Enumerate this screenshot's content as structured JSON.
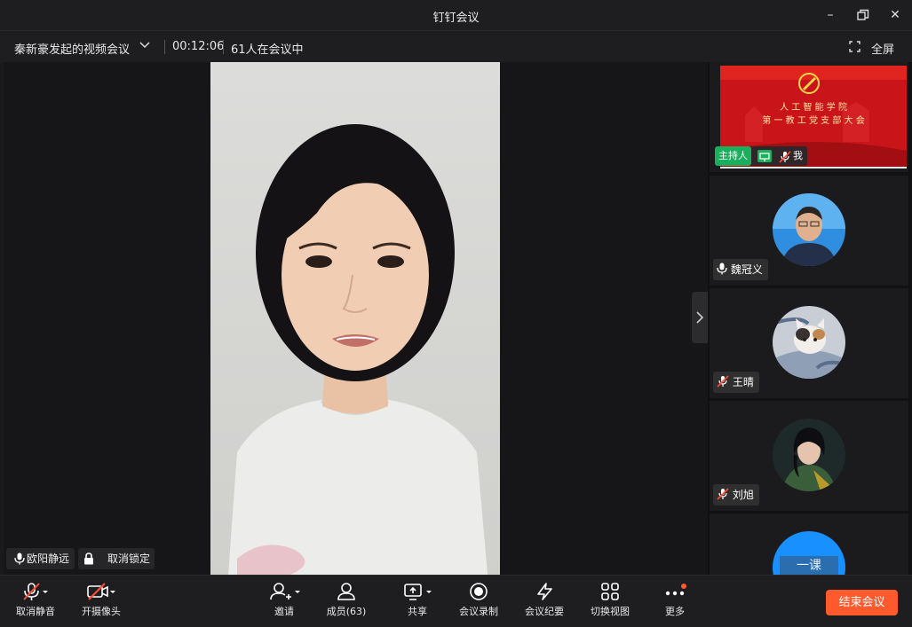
{
  "window": {
    "title": "钉钉会议"
  },
  "meeting": {
    "name": "秦新豪发起的视频会议",
    "duration": "00:12:06",
    "participants_in_meeting": "61人在会议中",
    "fullscreen_label": "全屏"
  },
  "main_video": {
    "speaker_name": "欧阳静远",
    "unlock_label": "取消锁定"
  },
  "sidebar": {
    "tiles": [
      {
        "kind": "slide",
        "slide_line1": "人 工 智 能 学 院",
        "slide_line2": "第 一 教 工 党 支 部 大 会",
        "host_label": "主持人",
        "self_label": "我"
      },
      {
        "kind": "person",
        "name": "魏冠义",
        "muted": false
      },
      {
        "kind": "person",
        "name": "王晴",
        "muted": true
      },
      {
        "kind": "person",
        "name": "刘旭",
        "muted": true
      },
      {
        "kind": "person",
        "name": "",
        "avatar_text": "一课",
        "muted": true
      }
    ]
  },
  "toolbar": {
    "unmute": "取消静音",
    "camera": "开摄像头",
    "invite": "邀请",
    "members": "成员(63)",
    "share": "共享",
    "record": "会议录制",
    "minutes": "会议纪要",
    "switch_view": "切换视图",
    "more": "更多",
    "end": "结束会议"
  },
  "colors": {
    "accent": "#ff5a2e",
    "host_badge": "#1aaf5d",
    "bg": "#1a1a1c"
  }
}
